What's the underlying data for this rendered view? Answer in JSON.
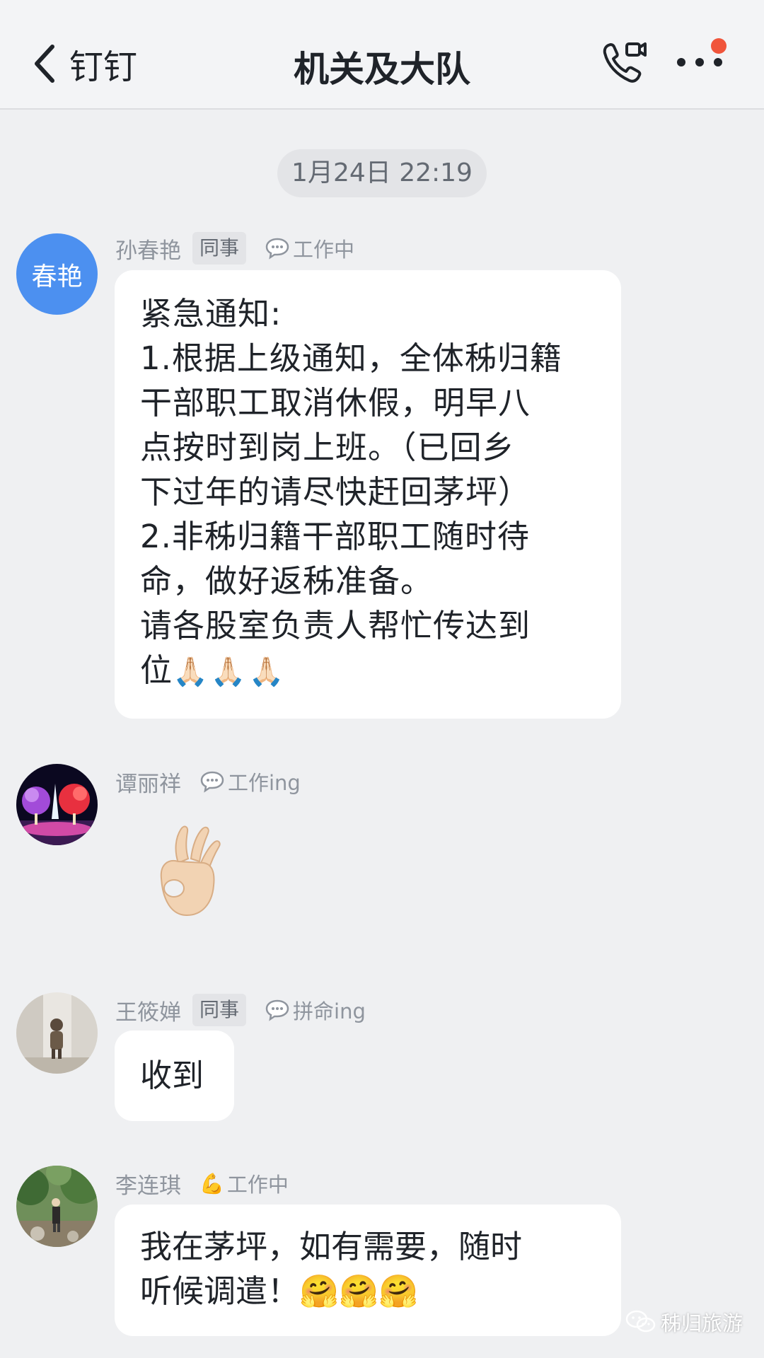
{
  "header": {
    "back_label": "钉钉",
    "title": "机关及大队",
    "call_icon": "phone-video-icon",
    "more_icon": "more-dots-icon",
    "notification_color": "#f0553b"
  },
  "timestamp": "1月24日 22:19",
  "messages": [
    {
      "avatar_text": "春艳",
      "name": "孙春艳",
      "tag": "同事",
      "status": "工作中",
      "lines": [
        "紧急通知:",
        "1.根据上级通知，全体秭归籍",
        "干部职工取消休假，明早八",
        "点按时到岗上班。（已回乡",
        "下过年的请尽快赶回茅坪）",
        "2.非秭归籍干部职工随时待",
        "命，做好返秭准备。",
        "请各股室负责人帮忙传达到",
        "位"
      ],
      "trailing_emoji": "🙏🏻🙏🏻🙏🏻"
    },
    {
      "name": "谭丽祥",
      "status": "工作ing",
      "sticker": "ok-hand-emoji"
    },
    {
      "name": "王筱婵",
      "tag": "同事",
      "status": "拼命ing",
      "text": "收到"
    },
    {
      "name": "李连琪",
      "status_emoji": "💪",
      "status": "工作中",
      "lines": [
        "我在茅坪，如有需要，随时",
        "听候调遣！"
      ],
      "trailing_emoji": "🤗🤗🤗"
    }
  ],
  "watermark": "秭归旅游",
  "accent": "#4c90f0"
}
